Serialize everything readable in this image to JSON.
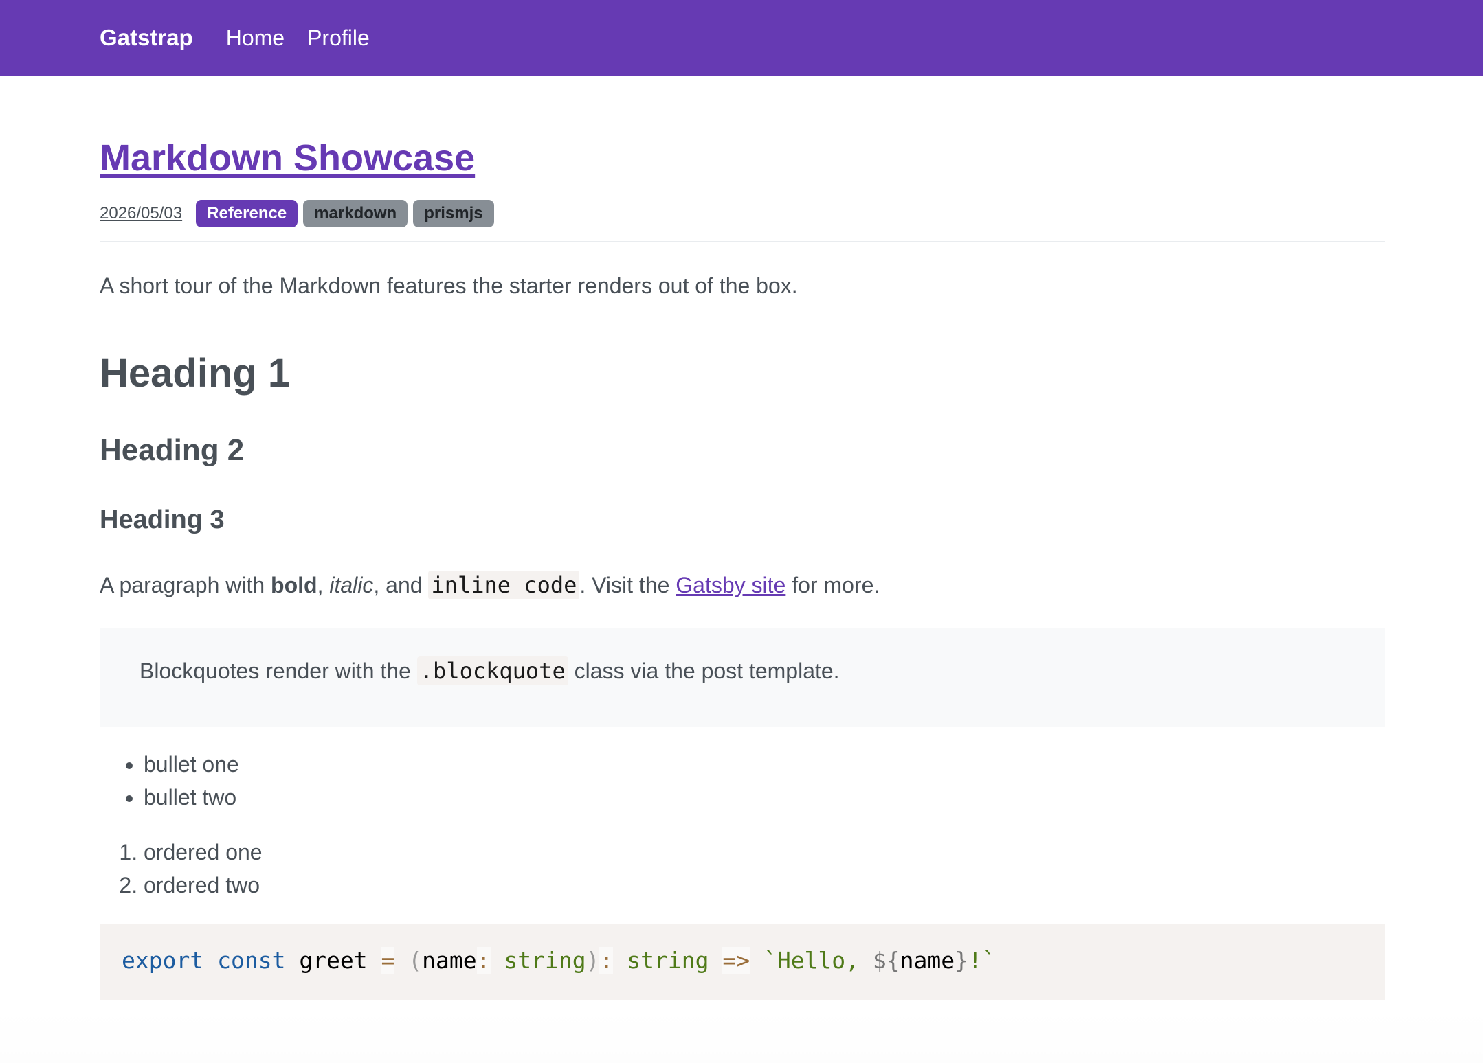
{
  "navbar": {
    "brand": "Gatstrap",
    "links": [
      "Home",
      "Profile"
    ],
    "bg_color": "#663ab3"
  },
  "post": {
    "title": "Markdown Showcase",
    "date": "2026/05/03",
    "badges": [
      "Reference",
      "markdown",
      "prismjs"
    ],
    "lead": "A short tour of the Markdown features the starter renders out of the box.",
    "h1": "Heading 1",
    "h2": "Heading 2",
    "h3": "Heading 3",
    "paragraph": {
      "prefix": "A paragraph with ",
      "bold": "bold",
      "sep1": ", ",
      "italic": "italic",
      "sep2": ", and ",
      "code": "inline code",
      "mid": ". Visit the ",
      "link": "Gatsby site",
      "suffix": " for more."
    },
    "blockquote": {
      "prefix": "Blockquotes render with the ",
      "code": ".blockquote",
      "suffix": " class via the post template."
    },
    "bullets": [
      "bullet one",
      "bullet two"
    ],
    "ordered": [
      "ordered one",
      "ordered two"
    ],
    "code_block": {
      "tokens": [
        "export",
        "const",
        "greet",
        "=",
        "(",
        "name",
        ":",
        "string",
        ")",
        ":",
        "string",
        "=>",
        "`Hello, ",
        "${",
        "name",
        "}",
        "!`"
      ]
    }
  }
}
